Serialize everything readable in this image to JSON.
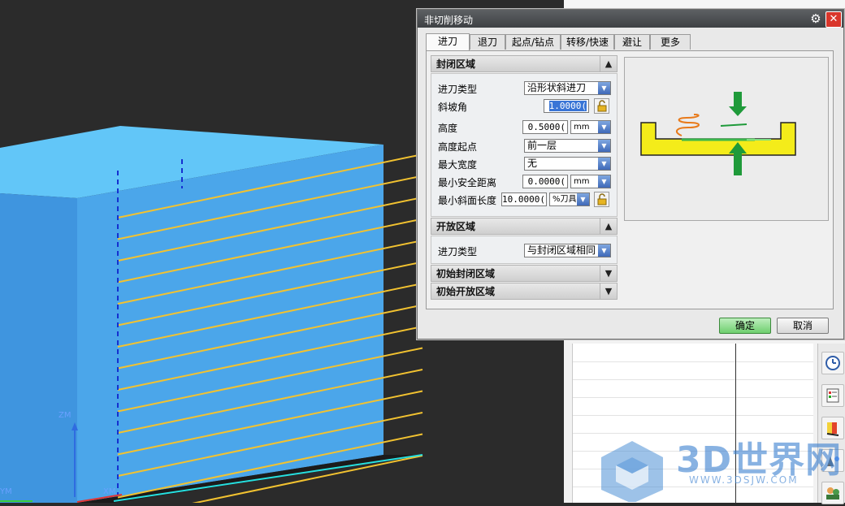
{
  "viewport": {
    "axis_zm": "ZM",
    "axis_xm": "XM",
    "axis_ym": "YM"
  },
  "dialog": {
    "title": "非切削移动",
    "tabs": [
      "进刀",
      "退刀",
      "起点/钻点",
      "转移/快速",
      "避让",
      "更多"
    ],
    "active_tab": "进刀",
    "closed_area": {
      "header": "封闭区域",
      "rows": {
        "engage_type": {
          "label": "进刀类型",
          "value": "沿形状斜进刀"
        },
        "ramp_angle": {
          "label": "斜坡角",
          "value": "1.0000("
        },
        "height": {
          "label": "高度",
          "value": "0.5000(",
          "unit": "mm"
        },
        "height_from": {
          "label": "高度起点",
          "value": "前一层"
        },
        "max_width": {
          "label": "最大宽度",
          "value": "无"
        },
        "min_safe_dist": {
          "label": "最小安全距离",
          "value": "0.0000(",
          "unit": "mm"
        },
        "min_ramp_len": {
          "label": "最小斜面长度",
          "value": "10.0000(",
          "unit": "%刀具"
        }
      }
    },
    "open_area": {
      "header": "开放区域",
      "engage_type": {
        "label": "进刀类型",
        "value": "与封闭区域相同"
      }
    },
    "initial_closed": {
      "header": "初始封闭区域"
    },
    "initial_open": {
      "header": "初始开放区域"
    },
    "ok": "确定",
    "cancel": "取消"
  },
  "watermark": {
    "title": "3D世界网",
    "url": "WWW.3DSJW.COM"
  },
  "colors": {
    "part_top": "#5fc3f7",
    "part_side": "#4aa0e6",
    "toolpath": "#f2c230",
    "accent_green": "#1f9a3a",
    "yellow_part": "#f4ec1a"
  }
}
